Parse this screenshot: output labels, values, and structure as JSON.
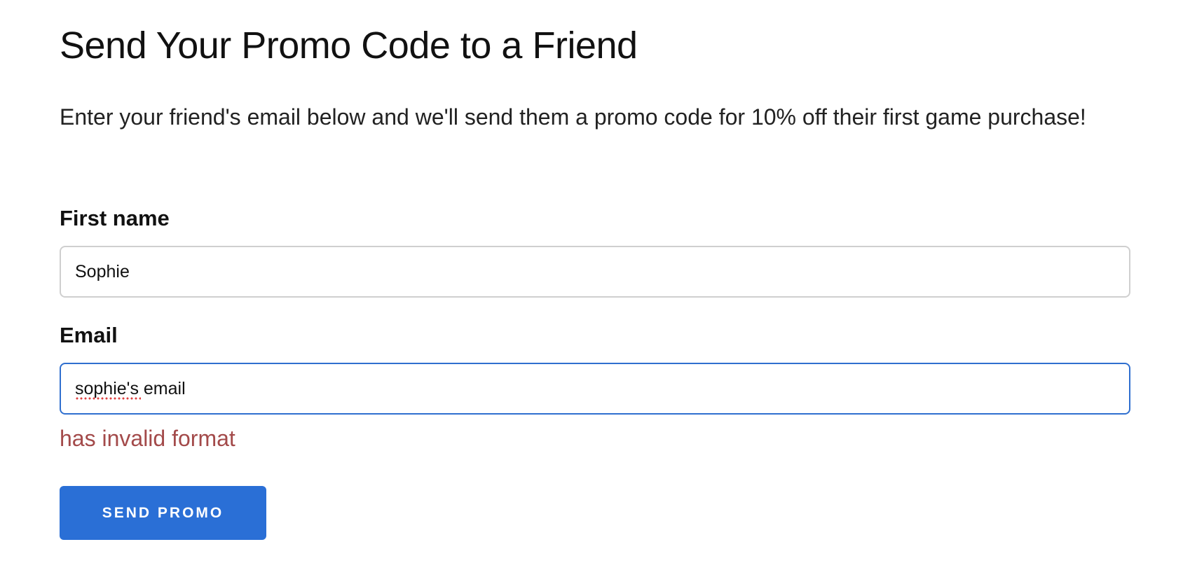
{
  "page": {
    "title": "Send Your Promo Code to a Friend",
    "intro": "Enter your friend's email below and we'll send them a promo code for 10% off their first game purchase!"
  },
  "form": {
    "first_name": {
      "label": "First name",
      "value": "Sophie"
    },
    "email": {
      "label": "Email",
      "value": "sophie's email",
      "error": "has invalid format"
    },
    "submit_label": "SEND PROMO"
  },
  "colors": {
    "accent": "#2a6fd6",
    "focus_border": "#2f6fcf",
    "error": "#a34a4a"
  }
}
